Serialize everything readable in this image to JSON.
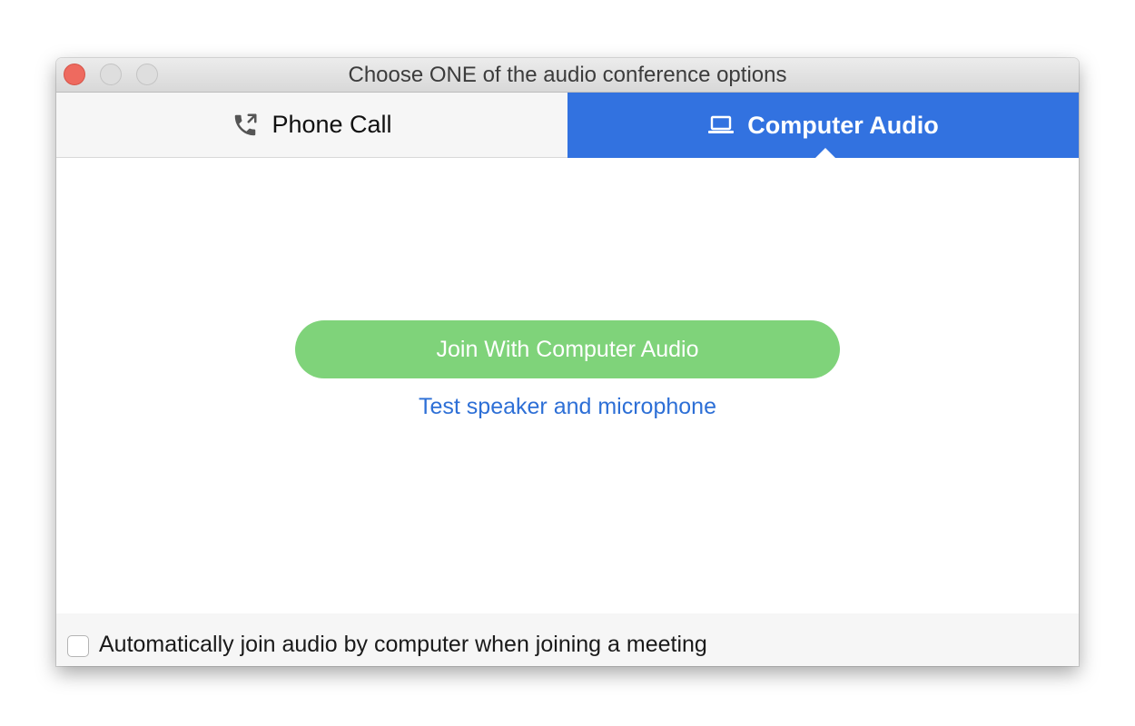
{
  "window": {
    "title": "Choose ONE of the audio conference options"
  },
  "tabs": [
    {
      "label": "Phone Call",
      "icon": "phone-icon",
      "selected": false
    },
    {
      "label": "Computer Audio",
      "icon": "laptop-icon",
      "selected": true
    }
  ],
  "main": {
    "join_button_label": "Join With Computer Audio",
    "test_link_label": "Test speaker and microphone"
  },
  "footer": {
    "auto_join_label": "Automatically join audio by computer when joining a meeting",
    "auto_join_checked": false
  },
  "colors": {
    "accent": "#3272e0",
    "join_button": "#7fd37a",
    "link": "#2d6fd6",
    "close_button": "#ee6a5f"
  }
}
